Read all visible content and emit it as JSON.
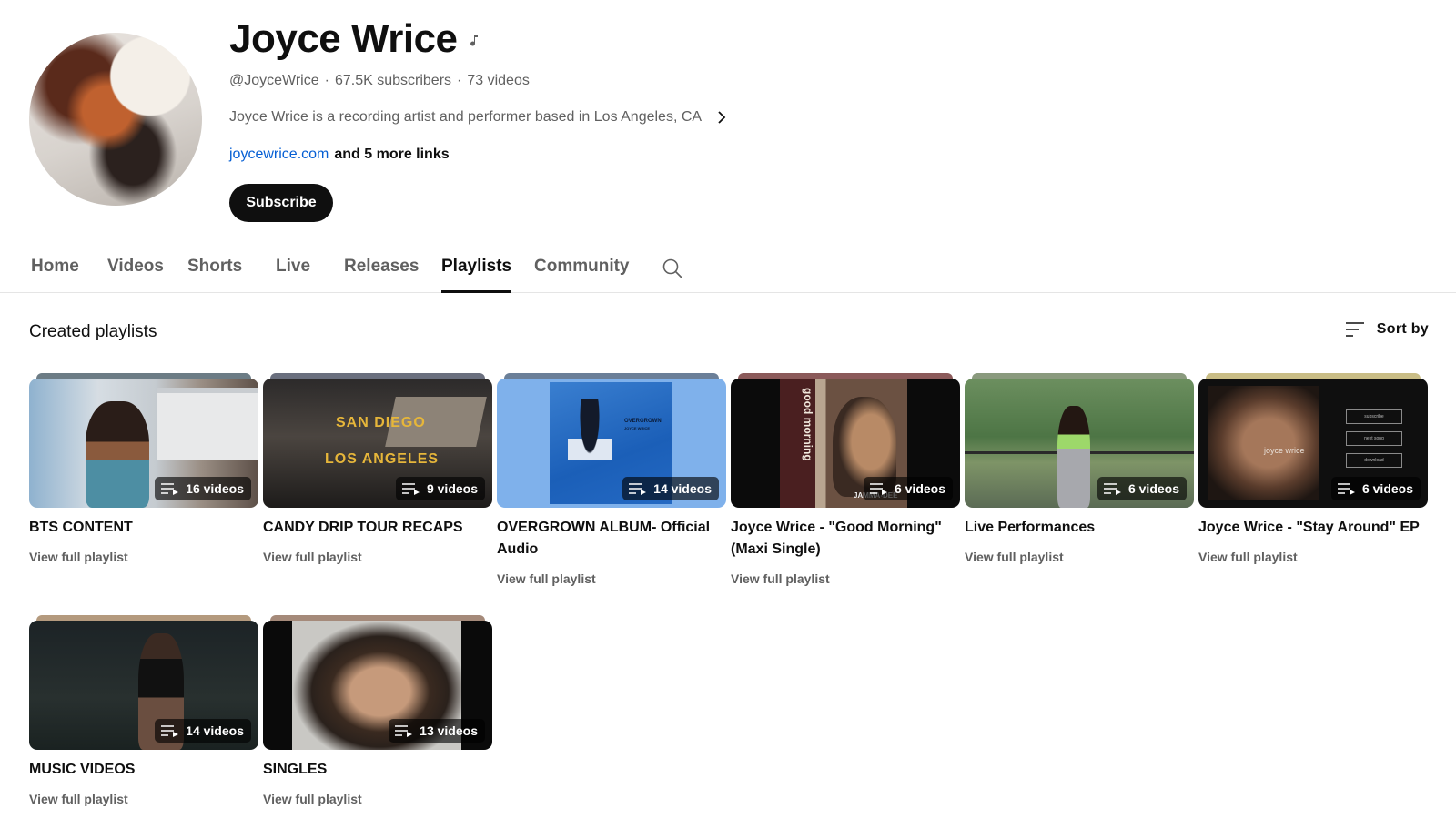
{
  "channel": {
    "name": "Joyce Wrice",
    "handle": "@JoyceWrice",
    "subscribers": "67.5K subscribers",
    "videos": "73 videos",
    "separator": "·",
    "description": "Joyce Wrice is a recording artist and performer based in Los Angeles, CA",
    "link": "joycewrice.com",
    "more_links": "and 5 more links",
    "subscribe_label": "Subscribe"
  },
  "tabs": [
    {
      "label": "Home"
    },
    {
      "label": "Videos"
    },
    {
      "label": "Shorts"
    },
    {
      "label": "Live"
    },
    {
      "label": "Releases"
    },
    {
      "label": "Playlists",
      "active": true
    },
    {
      "label": "Community"
    }
  ],
  "section": {
    "title": "Created playlists",
    "sort_label": "Sort by"
  },
  "playlists": [
    {
      "title": "BTS CONTENT",
      "count": "16 videos",
      "link": "View full playlist",
      "stack_color": "#6c7c85"
    },
    {
      "title": "CANDY DRIP TOUR RECAPS",
      "count": "9 videos",
      "link": "View full playlist",
      "stack_color": "#6a6f7e",
      "overlay_lines": [
        "SAN DIEGO",
        "LOS ANGELES"
      ]
    },
    {
      "title": "OVERGROWN ALBUM- Official Audio",
      "count": "14 videos",
      "link": "View full playlist",
      "stack_color": "#6b7f98",
      "overlay_lines": [
        "OVERGROWN",
        "JOYCE WRICE"
      ]
    },
    {
      "title": "Joyce Wrice - \"Good Morning\" (Maxi Single)",
      "count": "6 videos",
      "link": "View full playlist",
      "stack_color": "#8b5a5a",
      "overlay_lines": [
        "good morning",
        "JAMMA-DEE"
      ]
    },
    {
      "title": "Live Performances",
      "count": "6 videos",
      "link": "View full playlist",
      "stack_color": "#8a9a7e"
    },
    {
      "title": "Joyce Wrice - \"Stay Around\" EP",
      "count": "6 videos",
      "link": "View full playlist",
      "stack_color": "#c9bd86",
      "overlay_lines": [
        "joyce wrice",
        "subscribe",
        "next song",
        "download"
      ]
    },
    {
      "title": "MUSIC VIDEOS",
      "count": "14 videos",
      "link": "View full playlist",
      "stack_color": "#b49a7e"
    },
    {
      "title": "SINGLES",
      "count": "13 videos",
      "link": "View full playlist",
      "stack_color": "#a58a7a"
    }
  ]
}
